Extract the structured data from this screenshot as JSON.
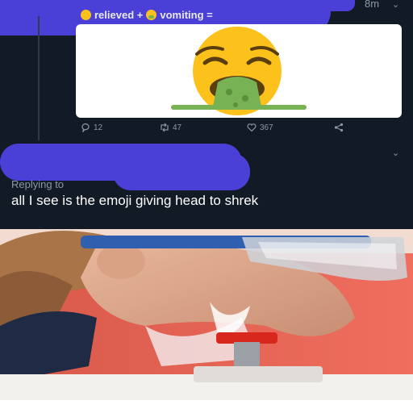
{
  "tweet": {
    "timestamp": "8m",
    "title_parts": [
      "relieved +",
      "vomiting ="
    ],
    "icons": {
      "relieved": "relieved-face-emoji-icon",
      "vomiting": "vomiting-face-emoji-icon",
      "reply": "reply-icon",
      "retweet": "retweet-icon",
      "like": "heart-icon",
      "share": "share-icon",
      "more": "chevron-down-icon"
    },
    "stats": {
      "replies": "12",
      "retweets": "47",
      "likes": "367"
    }
  },
  "reply": {
    "replying_to_label": "Replying to",
    "text": "all I see is the emoji giving head to shrek"
  },
  "colors": {
    "background": "#121a26",
    "redaction": "#4a3fd6",
    "muted_text": "#8b98a5",
    "emoji_yellow": "#fcc21b",
    "emoji_green": "#77b255"
  }
}
